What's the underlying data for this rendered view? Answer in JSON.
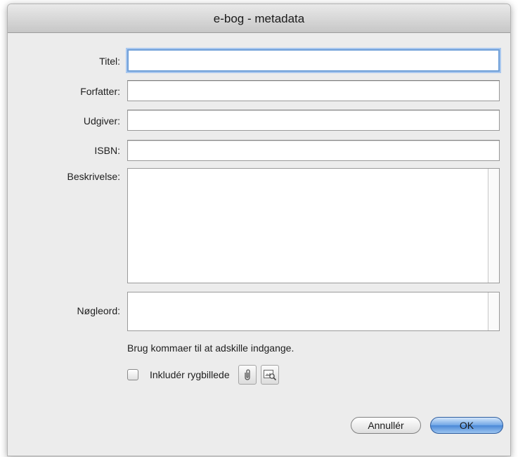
{
  "window": {
    "title": "e-bog - metadata"
  },
  "form": {
    "title_label": "Titel:",
    "title_value": "",
    "author_label": "Forfatter:",
    "author_value": "",
    "publisher_label": "Udgiver:",
    "publisher_value": "",
    "isbn_label": "ISBN:",
    "isbn_value": "",
    "description_label": "Beskrivelse:",
    "description_value": "",
    "keywords_label": "Nøgleord:",
    "keywords_value": "",
    "keywords_hint": "Brug kommaer til at adskille indgange.",
    "include_cover_label": "Inkludér rygbillede",
    "include_cover_checked": false
  },
  "icons": {
    "attach": "paperclip-icon",
    "preview": "image-preview-icon"
  },
  "buttons": {
    "cancel": "Annullér",
    "ok": "OK"
  },
  "colors": {
    "focus_ring": "#6f9fd8",
    "default_button": "#4a88d7",
    "dialog_background": "#ececec"
  }
}
